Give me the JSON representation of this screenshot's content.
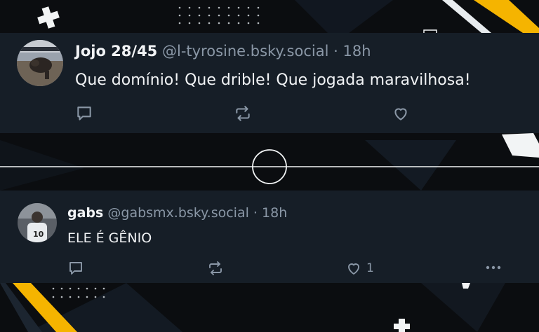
{
  "posts": [
    {
      "display_name": "Jojo 28/45",
      "handle": "@l-tyrosine.bsky.social",
      "separator": " · ",
      "time": "18h",
      "text": "Que domínio! Que drible! Que jogada maravilhosa!"
    },
    {
      "display_name": "gabs",
      "handle": "@gabsmx.bsky.social",
      "separator": " · ",
      "time": "18h",
      "text": "ELE É GÊNIO",
      "like_count": "1"
    }
  ],
  "colors": {
    "post_bg": "#161e27",
    "page_bg": "#0b0d10",
    "accent_yellow": "#f5b400",
    "muted_text": "#8a97a6"
  },
  "icons": [
    "reply-icon",
    "repost-icon",
    "like-icon",
    "more-icon"
  ]
}
